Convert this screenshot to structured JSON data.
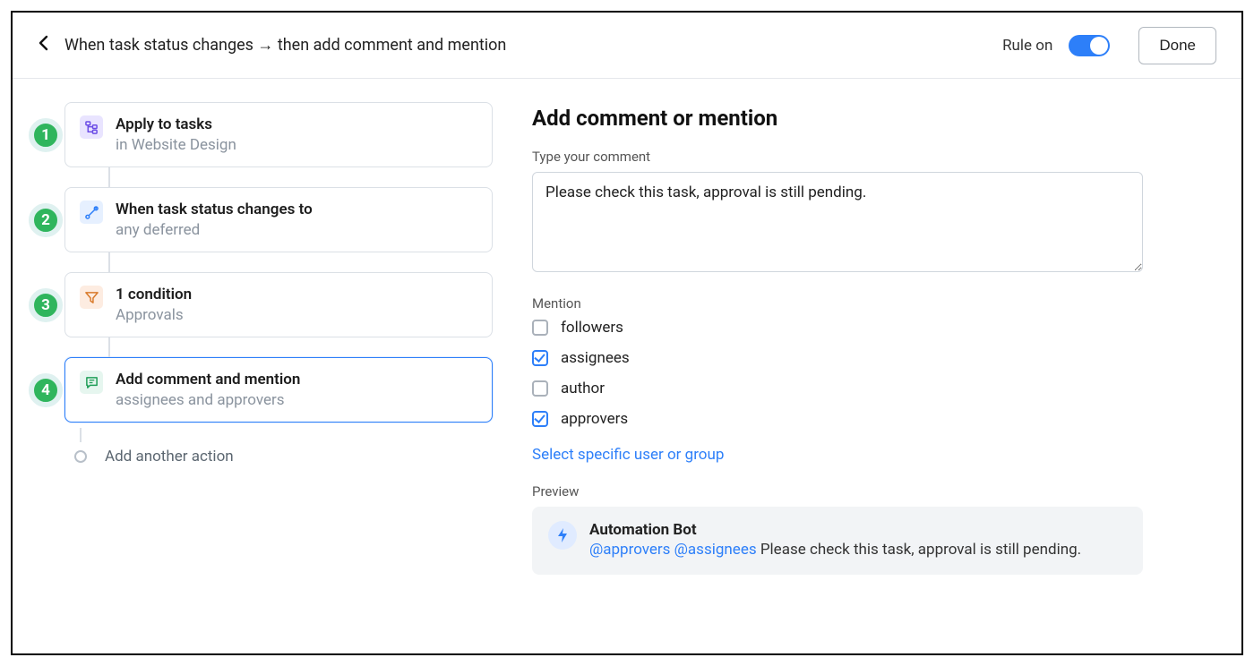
{
  "header": {
    "title": "When task status changes → then add comment and mention",
    "rule_toggle_label": "Rule on",
    "done_label": "Done"
  },
  "steps": [
    {
      "badge": "1",
      "icon": "tree-icon",
      "icon_class": "icon-tasks",
      "title": "Apply to tasks",
      "sub": "in Website Design"
    },
    {
      "badge": "2",
      "icon": "branch-icon",
      "icon_class": "icon-status",
      "title": "When task status changes to",
      "sub": "any deferred"
    },
    {
      "badge": "3",
      "icon": "filter-icon",
      "icon_class": "icon-filter",
      "title": "1 condition",
      "sub": "Approvals"
    },
    {
      "badge": "4",
      "icon": "comment-icon",
      "icon_class": "icon-comment",
      "title": "Add comment and mention",
      "sub": "assignees and approvers",
      "selected": true
    }
  ],
  "add_action_label": "Add another action",
  "panel": {
    "heading": "Add comment or mention",
    "comment_label": "Type your comment",
    "comment_value": "Please check this task, approval is still pending.",
    "mention_label": "Mention",
    "mention_options": [
      {
        "label": "followers",
        "checked": false
      },
      {
        "label": "assignees",
        "checked": true
      },
      {
        "label": "author",
        "checked": false
      },
      {
        "label": "approvers",
        "checked": true
      }
    ],
    "select_user_link": "Select specific user or group",
    "preview_label": "Preview",
    "preview": {
      "bot_name": "Automation Bot",
      "mentions": [
        "@approvers",
        "@assignees"
      ],
      "message": "Please check this task, approval is still pending."
    }
  }
}
